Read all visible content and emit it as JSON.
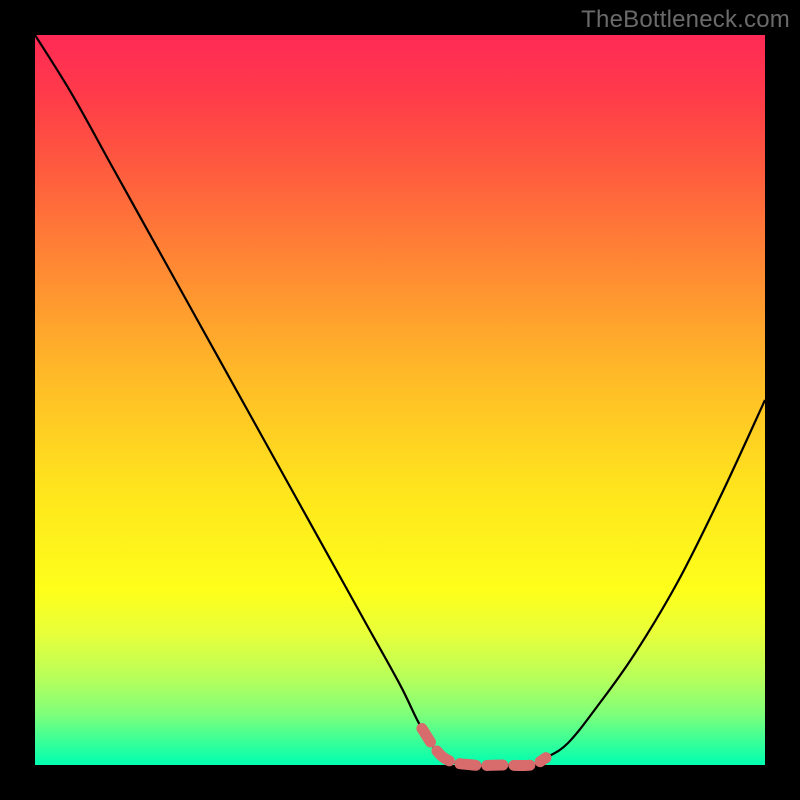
{
  "watermark": "TheBottleneck.com",
  "chart_data": {
    "type": "line",
    "title": "",
    "xlabel": "",
    "ylabel": "",
    "xlim": [
      0,
      100
    ],
    "ylim": [
      0,
      100
    ],
    "gradient_stops": [
      {
        "pos": 0,
        "color": "#ff2a55"
      },
      {
        "pos": 18,
        "color": "#ff5a3f"
      },
      {
        "pos": 46,
        "color": "#ffb828"
      },
      {
        "pos": 76,
        "color": "#feff1a"
      },
      {
        "pos": 100,
        "color": "#00ffb0"
      }
    ],
    "series": [
      {
        "name": "bottleneck-curve",
        "x": [
          0,
          5,
          10,
          15,
          20,
          25,
          30,
          35,
          40,
          45,
          50,
          53,
          56,
          60,
          64,
          68,
          70,
          73,
          77,
          82,
          88,
          94,
          100
        ],
        "y": [
          100,
          92,
          83,
          74,
          65,
          56,
          47,
          38,
          29,
          20,
          11,
          5,
          1,
          0,
          0,
          0,
          1,
          3,
          8,
          15,
          25,
          37,
          50
        ]
      },
      {
        "name": "highlight-segment",
        "x": [
          53,
          56,
          60,
          64,
          68,
          70
        ],
        "y": [
          5,
          1,
          0,
          0,
          0,
          1
        ]
      }
    ],
    "highlight_color": "#d86b6b",
    "curve_color": "#000000"
  }
}
